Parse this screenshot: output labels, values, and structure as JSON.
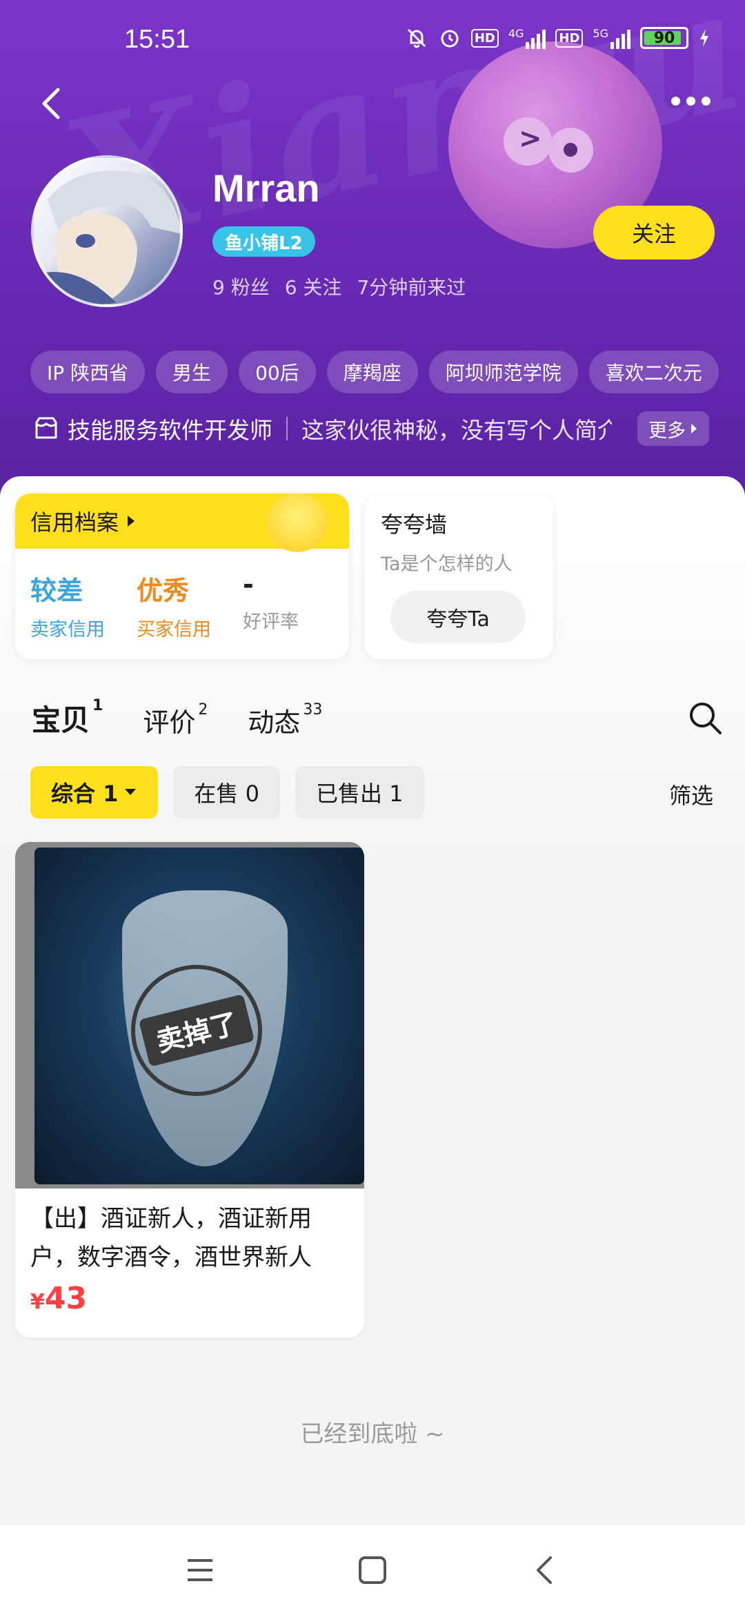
{
  "status_bar": {
    "time": "15:51",
    "network_1": "4G",
    "network_2": "5G",
    "hd": "HD",
    "battery": "90"
  },
  "header": {
    "watermark": "Xianyu",
    "username": "Mrran",
    "shop_badge": "鱼小铺L2",
    "fans": "9 粉丝",
    "following": "6 关注",
    "last_seen": "7分钟前来过",
    "follow_label": "关注"
  },
  "tags": [
    "IP 陕西省",
    "男生",
    "00后",
    "摩羯座",
    "阿坝师范学院",
    "喜欢二次元"
  ],
  "bio": {
    "skill": "技能服务软件开发师",
    "intro": "这家伙很神秘，没有写个人简介",
    "more_label": "更多"
  },
  "credit": {
    "title": "信用档案",
    "items": [
      {
        "value": "较差",
        "label": "卖家信用",
        "color": "#3aa6e0"
      },
      {
        "value": "优秀",
        "label": "买家信用",
        "color": "#f08a1c"
      },
      {
        "value": "-",
        "label": "好评率",
        "color": "#1a1a1a"
      }
    ]
  },
  "praise": {
    "title": "夸夸墙",
    "subtitle": "Ta是个怎样的人",
    "button": "夸夸Ta"
  },
  "tabs": [
    {
      "label": "宝贝",
      "count": "1"
    },
    {
      "label": "评价",
      "count": "2"
    },
    {
      "label": "动态",
      "count": "33"
    }
  ],
  "filters": {
    "items": [
      "综合 1",
      "在售 0",
      "已售出 1"
    ],
    "filter_label": "筛选"
  },
  "products": [
    {
      "title": "【出】酒证新人，酒证新用户，数字酒令，酒世界新人",
      "currency": "¥",
      "price": "43",
      "stamp": "卖掉了"
    }
  ],
  "end_text": "已经到底啦 ~",
  "colors": {
    "accent": "#ffe01a",
    "header_purple": "#6b2bb8",
    "price_red": "#ff4040"
  }
}
